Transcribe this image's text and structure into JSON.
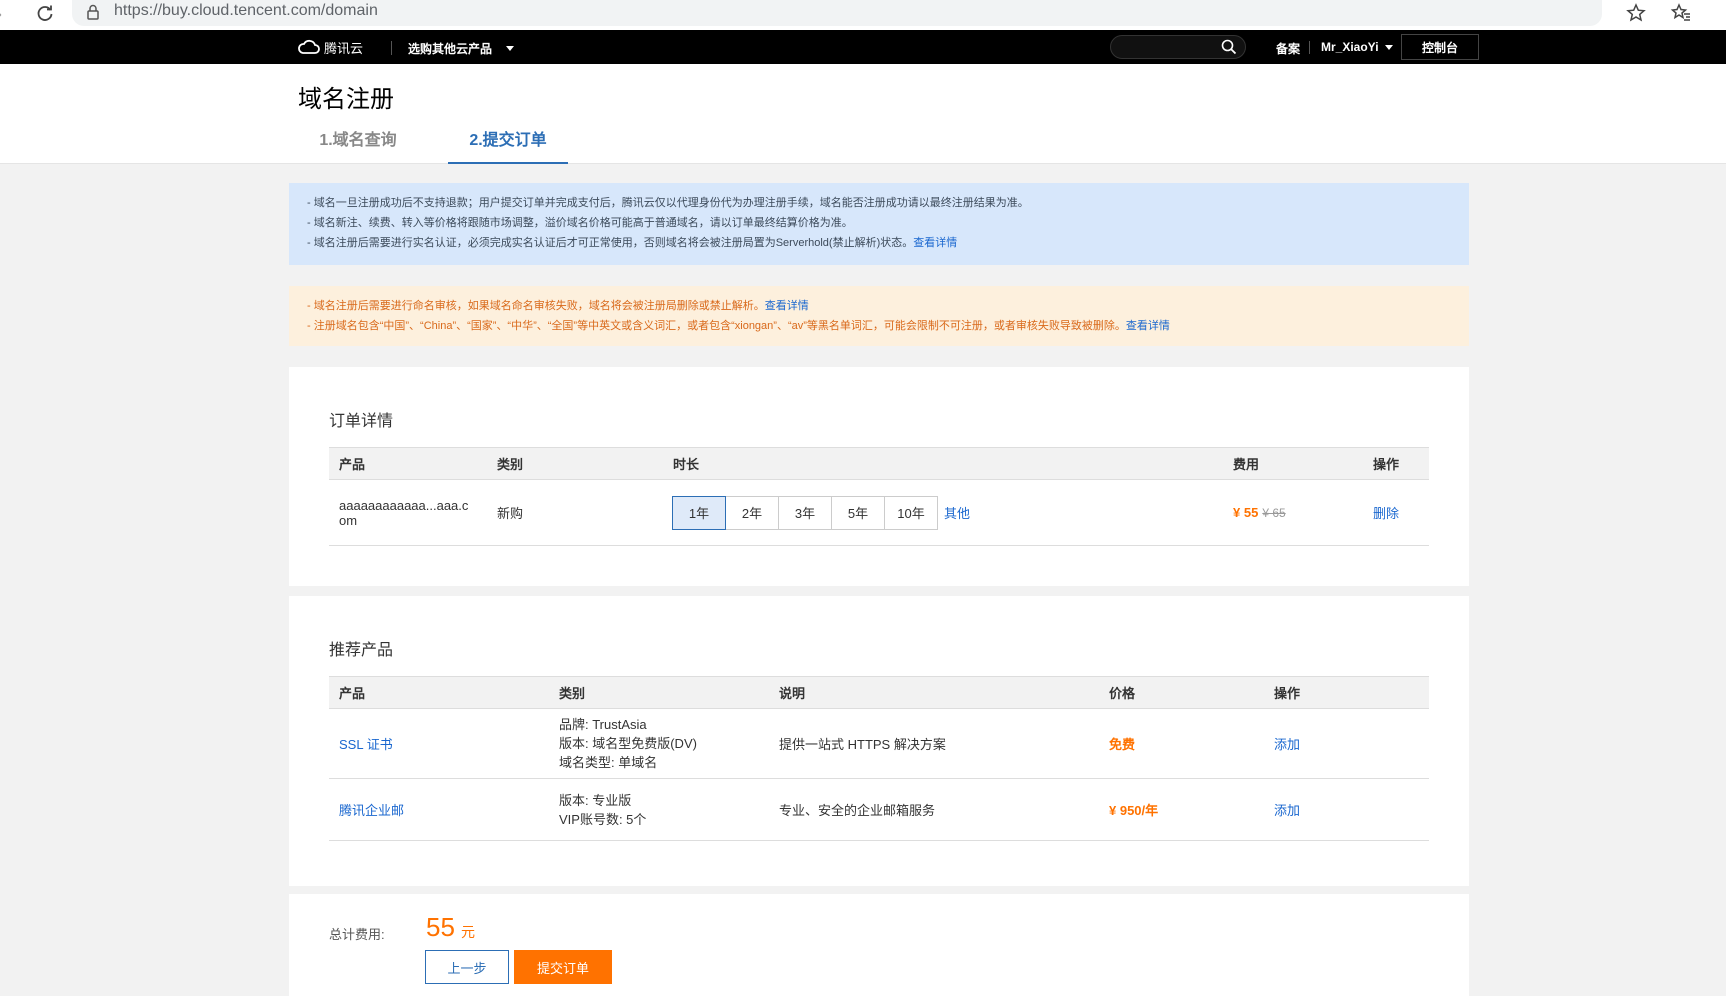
{
  "browser": {
    "url": "https://buy.cloud.tencent.com/domain"
  },
  "topnav": {
    "logo_text": "腾讯云",
    "buy_other": "选购其他云产品",
    "search_placeholder": "",
    "beian": "备案",
    "username": "Mr_XiaoYi",
    "console": "控制台"
  },
  "header": {
    "title": "域名注册",
    "tabs": [
      {
        "label": "1.域名查询"
      },
      {
        "label": "2.提交订单"
      }
    ]
  },
  "notices": {
    "blue": [
      {
        "text": "- 域名一旦注册成功后不支持退款；用户提交订单并完成支付后，腾讯云仅以代理身份代为办理注册手续，域名能否注册成功请以最终注册结果为准。",
        "link": ""
      },
      {
        "text": "- 域名新注、续费、转入等价格将跟随市场调整，溢价域名价格可能高于普通域名，请以订单最终结算价格为准。",
        "link": ""
      },
      {
        "text": "- 域名注册后需要进行实名认证，必须完成实名认证后才可正常使用，否则域名将会被注册局置为Serverhold(禁止解析)状态。",
        "link": "查看详情"
      }
    ],
    "orange": [
      {
        "text": "- 域名注册后需要进行命名审核，如果域名命名审核失败，域名将会被注册局删除或禁止解析。",
        "link": "查看详情"
      },
      {
        "text": "- 注册域名包含“中国”、“China”、“国家”、“中华”、“全国”等中英文或含义词汇，或者包含“xiongan”、“av”等黑名单词汇，可能会限制不可注册，或者审核失败导致被删除。",
        "link": "查看详情"
      }
    ]
  },
  "order": {
    "title": "订单详情",
    "headers": {
      "product": "产品",
      "type": "类别",
      "duration": "时长",
      "fee": "费用",
      "action": "操作"
    },
    "row": {
      "product_line1": "aaaaaaaaaaaa...aaa.c",
      "product_line2": "om",
      "type": "新购",
      "durations": [
        "1年",
        "2年",
        "3年",
        "5年",
        "10年"
      ],
      "selected_duration": "1年",
      "other": "其他",
      "price": "¥ 55",
      "original_price": "¥ 65",
      "action": "删除"
    }
  },
  "recommend": {
    "title": "推荐产品",
    "headers": {
      "product": "产品",
      "type": "类别",
      "desc": "说明",
      "price": "价格",
      "action": "操作"
    },
    "rows": [
      {
        "product": "SSL 证书",
        "type_lines": [
          "品牌: TrustAsia",
          "版本: 域名型免费版(DV)",
          "域名类型: 单域名"
        ],
        "desc": "提供一站式 HTTPS 解决方案",
        "price": "免费",
        "action": "添加"
      },
      {
        "product": "腾讯企业邮",
        "type_lines": [
          "版本: 专业版",
          "VIP账号数: 5个"
        ],
        "desc": "专业、安全的企业邮箱服务",
        "price": "¥ 950/年",
        "action": "添加"
      }
    ]
  },
  "total": {
    "label": "总计费用:",
    "amount": "55",
    "unit": "元",
    "prev": "上一步",
    "submit": "提交订单"
  },
  "colors": {
    "accent_orange": "#ff7200",
    "link_blue": "#1a67cf",
    "tab_blue": "#2c6eb5"
  }
}
